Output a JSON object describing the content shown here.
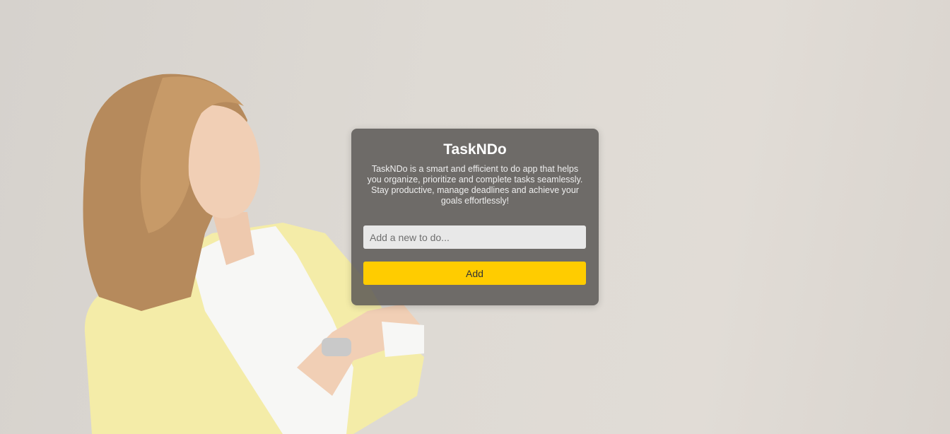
{
  "app": {
    "title": "TaskNDo",
    "description": "TaskNDo is a smart and efficient to do app that helps you organize, prioritize and complete tasks seamlessly. Stay productive, manage deadlines and achieve your goals effortlessly!"
  },
  "form": {
    "input_value": "",
    "input_placeholder": "Add a new to do...",
    "add_label": "Add"
  },
  "colors": {
    "accent": "#ffcc00",
    "card_background": "#585654",
    "page_background": "#dcd8d2"
  },
  "icons": {
    "background": "woman-holding-notepad-photo"
  }
}
